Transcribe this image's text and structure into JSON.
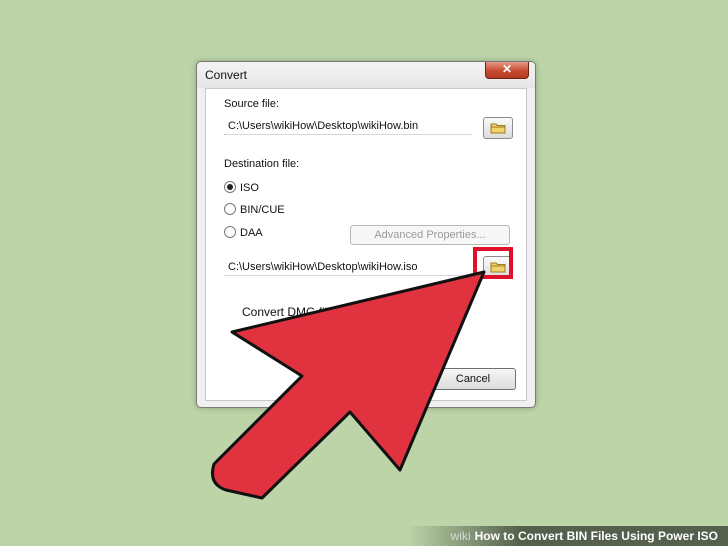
{
  "window": {
    "title": "Convert",
    "close_label": "✕"
  },
  "source": {
    "label": "Source file:",
    "path": "C:\\Users\\wikiHow\\Desktop\\wikiHow.bin"
  },
  "destination": {
    "label": "Destination file:",
    "options": [
      {
        "label": "ISO",
        "checked": true
      },
      {
        "label": "BIN/CUE",
        "checked": false
      },
      {
        "label": "DAA",
        "checked": false
      }
    ],
    "advanced_label": "Advanced Properties...",
    "path": "C:\\Users\\wikiHow\\Desktop\\wikiHow.iso"
  },
  "convert_dmg_label": "Convert DMG file to",
  "cancel_label": "Cancel",
  "footer": {
    "watermark": "wiki",
    "title": "How to Convert BIN Files Using Power ISO"
  },
  "colors": {
    "highlight": "#e0102a",
    "arrow": "#e0323f"
  }
}
